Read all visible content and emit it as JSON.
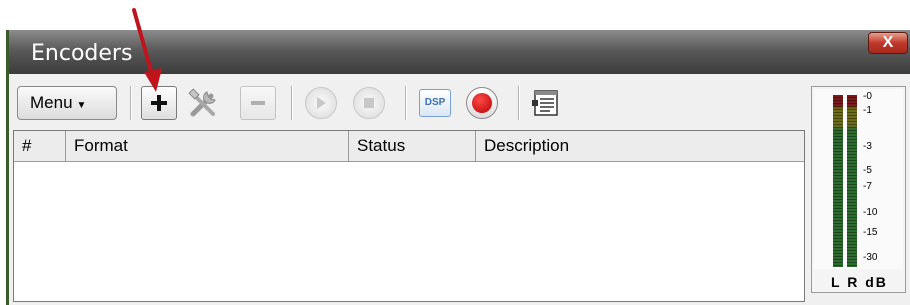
{
  "window": {
    "title": "Encoders",
    "close_glyph": "X"
  },
  "toolbar": {
    "menu_label": "Menu",
    "buttons": [
      {
        "icon": "plus-icon",
        "state": "enabled"
      },
      {
        "icon": "tools-icon",
        "state": "disabled"
      },
      {
        "icon": "minus-icon",
        "state": "disabled"
      },
      {
        "icon": "play-icon",
        "state": "disabled"
      },
      {
        "icon": "stop-icon",
        "state": "disabled"
      },
      {
        "icon": "dsp-icon",
        "label": "DSP",
        "state": "enabled"
      },
      {
        "icon": "record-icon",
        "state": "enabled"
      },
      {
        "icon": "properties-icon",
        "state": "enabled"
      }
    ]
  },
  "table": {
    "columns": [
      "#",
      "Format",
      "Status",
      "Description"
    ],
    "rows": []
  },
  "meter": {
    "scale": [
      "-0",
      "-1",
      "-3",
      "-5",
      "-7",
      "-10",
      "-15",
      "-30"
    ],
    "footer": "L R dB"
  },
  "annotation": {
    "arrow_color": "#c0141c",
    "points_to": "plus-icon"
  },
  "colors": {
    "titlebar": "#4a4a4a",
    "record": "#d40000",
    "dsp": "#3a6fb0"
  }
}
